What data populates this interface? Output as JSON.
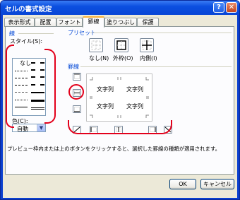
{
  "window": {
    "title": "セルの書式設定",
    "help_glyph": "?",
    "close_glyph": "✕"
  },
  "tabs": [
    {
      "label": "表示形式"
    },
    {
      "label": "配置"
    },
    {
      "label": "フォント"
    },
    {
      "label": "罫線"
    },
    {
      "label": "塗りつぶし"
    },
    {
      "label": "保護"
    }
  ],
  "active_tab": "罫線",
  "line_section": {
    "title": "線",
    "style_label": "スタイル(S):",
    "none_label": "なし",
    "color_label": "色(C):",
    "color_value": "自動"
  },
  "preset_section": {
    "title": "プリセット",
    "buttons": [
      {
        "label": "なし(N)",
        "icon": "preset-none-icon"
      },
      {
        "label": "外枠(O)",
        "icon": "preset-outline-icon"
      },
      {
        "label": "内側(I)",
        "icon": "preset-inside-icon"
      }
    ]
  },
  "border_section": {
    "title": "罫線",
    "preview_cells": [
      "文字列",
      "文字列",
      "文字列",
      "文字列"
    ]
  },
  "hint_text": "プレビュー枠内または上のボタンをクリックすると、選択した罫線の種類が適用されます。",
  "buttons": {
    "ok": "OK",
    "cancel": "キャンセル"
  },
  "colors": {
    "accent": "#e3001b",
    "group_title": "#0046d5",
    "title_bar": "#0b4fe0"
  }
}
